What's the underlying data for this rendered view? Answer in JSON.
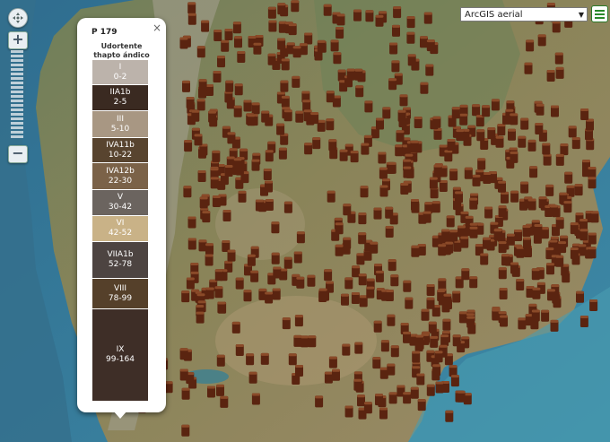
{
  "map": {
    "basemap_label": "ArcGIS aerial",
    "marker_color": "#5a2410"
  },
  "controls": {
    "pan_icon": "pan-arrows-icon",
    "zoom_in_label": "+",
    "zoom_out_label": "−",
    "menu_icon": "hamburger-menu-icon"
  },
  "popup": {
    "title": "P 179",
    "subtitle_line1": "Udortente",
    "subtitle_line2": "thapto ándico",
    "close_label": "×",
    "horizons": [
      {
        "name": "I",
        "depth": "0-2",
        "color": "#bcb3ab",
        "text": "#ffffff"
      },
      {
        "name": "IIA1b",
        "depth": "2-5",
        "color": "#3a2a21",
        "text": "#ffffff"
      },
      {
        "name": "III",
        "depth": "5-10",
        "color": "#a89783",
        "text": "#ffffff"
      },
      {
        "name": "IVA11b",
        "depth": "10-22",
        "color": "#58442f",
        "text": "#ffffff"
      },
      {
        "name": "IVA12b",
        "depth": "22-30",
        "color": "#7b6248",
        "text": "#ffffff"
      },
      {
        "name": "V",
        "depth": "30-42",
        "color": "#6b645f",
        "text": "#ffffff"
      },
      {
        "name": "VI",
        "depth": "42-52",
        "color": "#c9b287",
        "text": "#ffffff"
      },
      {
        "name": "VIIA1b",
        "depth": "52-78",
        "color": "#4d4441",
        "text": "#ffffff"
      },
      {
        "name": "VIII",
        "depth": "78-99",
        "color": "#55402a",
        "text": "#ffffff"
      },
      {
        "name": "IX",
        "depth": "99-164",
        "color": "#3e2e27",
        "text": "#ffffff"
      }
    ]
  }
}
